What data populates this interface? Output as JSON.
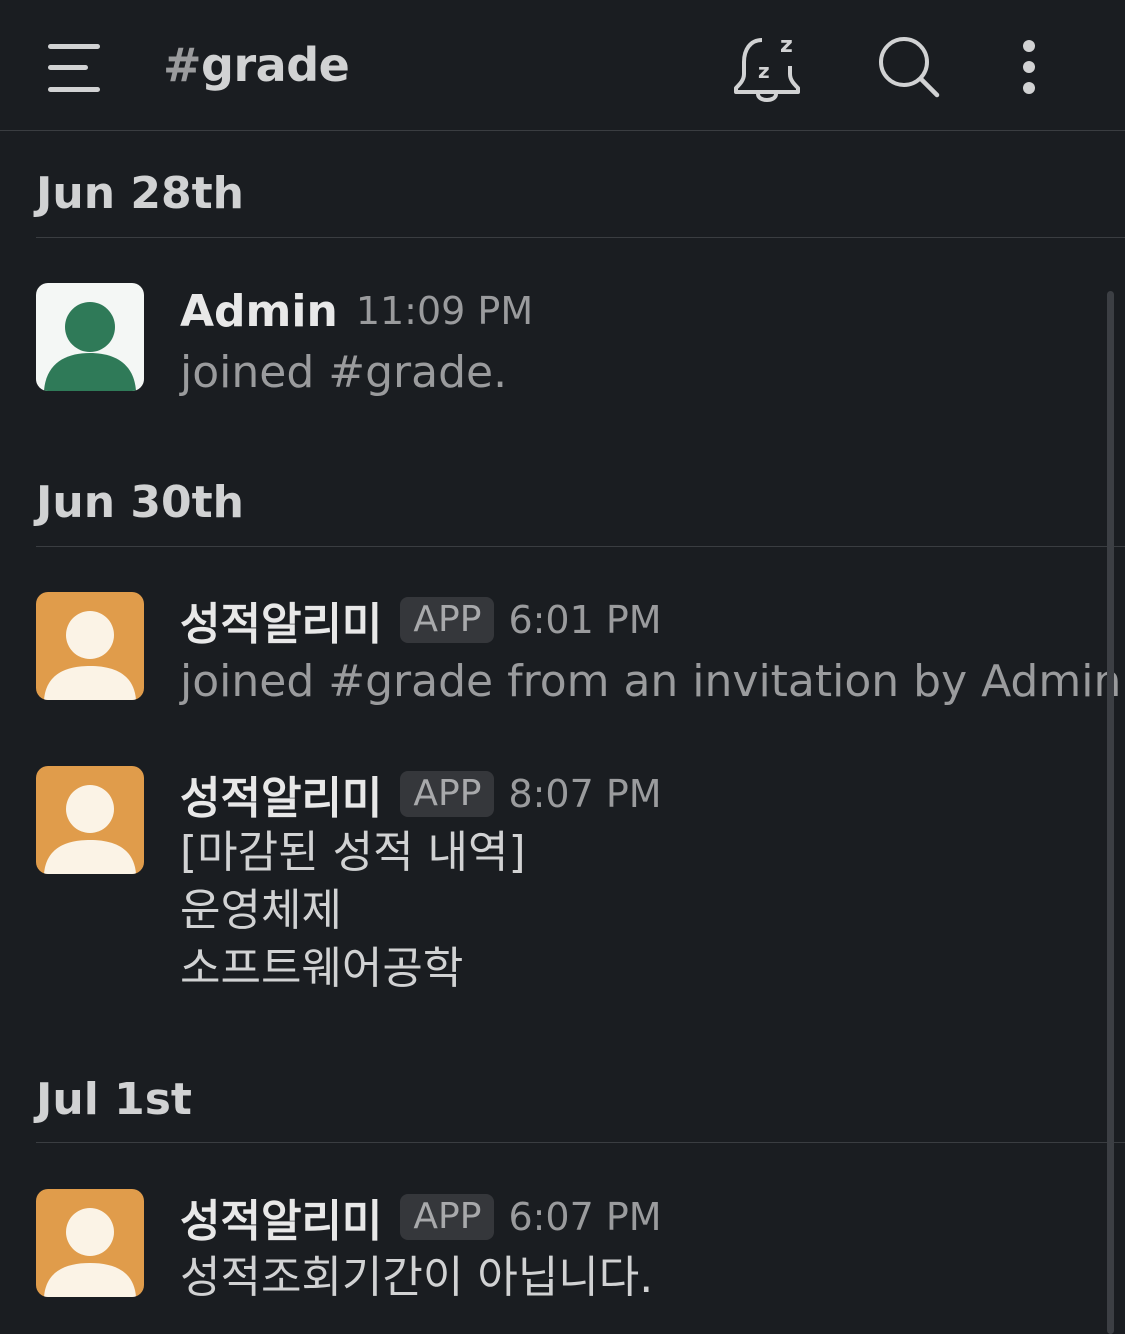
{
  "header": {
    "channel_hash": "#",
    "channel_name": "grade",
    "icons": {
      "menu": "hamburger-menu-icon",
      "snooze": "bell-snooze-icon",
      "search": "search-icon",
      "more": "more-vertical-icon"
    }
  },
  "colors": {
    "background": "#1a1d21",
    "admin_avatar": "#2f7a58",
    "app_avatar": "#e09c4b"
  },
  "sections": [
    {
      "date": "Jun 28th"
    },
    {
      "date": "Jun 30th"
    },
    {
      "date": "Jul 1st"
    }
  ],
  "messages": [
    {
      "sender": "Admin",
      "badge": "",
      "time": "11:09 PM",
      "text": "joined #grade."
    },
    {
      "sender": "성적알리미",
      "badge": "APP",
      "time": "6:01 PM",
      "text": "joined #grade from an invitation by Admin."
    },
    {
      "sender": "성적알리미",
      "badge": "APP",
      "time": "8:07 PM",
      "lines": [
        "[마감된 성적 내역]",
        "운영체제",
        "소프트웨어공학"
      ]
    },
    {
      "sender": "성적알리미",
      "badge": "APP",
      "time": "6:07 PM",
      "lines": [
        "성적조회기간이 아닙니다."
      ]
    }
  ]
}
